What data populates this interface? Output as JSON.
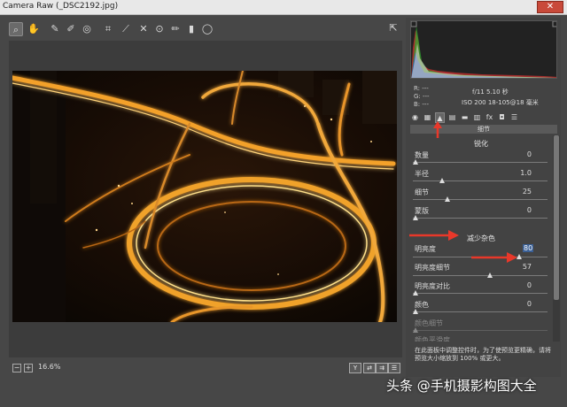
{
  "window": {
    "title": "Camera Raw (_DSC2192.jpg)",
    "close_icon": "close-icon"
  },
  "toolbar": {
    "tools": [
      "zoom-icon",
      "hand-icon",
      "eyedropper-icon",
      "color-sampler-icon",
      "target-adjust-icon",
      "crop-icon",
      "straighten-icon",
      "spot-removal-icon",
      "red-eye-icon",
      "adjustment-brush-icon",
      "graduated-filter-icon",
      "radial-filter-icon"
    ],
    "exit_icon": "open-preferences-icon"
  },
  "status": {
    "zoom_minus": "−",
    "zoom_plus": "+",
    "zoom_value": "16.6%",
    "view_y": "Y"
  },
  "info": {
    "r": "R:  ---",
    "g": "G:  ---",
    "b": "B:  ---",
    "aperture_time": "f/11   5.10 秒",
    "iso_lens": "ISO 200   18-105@18 毫米"
  },
  "panel": {
    "section_label": "细节",
    "sharpen": {
      "title": "锐化",
      "rows": [
        {
          "label": "数量",
          "value": "0"
        },
        {
          "label": "半径",
          "value": "1.0"
        },
        {
          "label": "细节",
          "value": "25"
        },
        {
          "label": "蒙版",
          "value": "0"
        }
      ]
    },
    "noise": {
      "title": "减少杂色",
      "rows": [
        {
          "label": "明亮度",
          "value": "80"
        },
        {
          "label": "明亮度细节",
          "value": "57"
        },
        {
          "label": "明亮度对比",
          "value": "0"
        },
        {
          "label": "颜色",
          "value": "0"
        },
        {
          "label": "颜色细节",
          "value": ""
        },
        {
          "label": "颜色平滑度",
          "value": ""
        }
      ]
    },
    "hint": "在此面板中调整控件时，为了使预览更精确，请将预览大小缩放到 100% 或更大。"
  },
  "watermark": "头条 @手机摄影构图大全",
  "colors": {
    "accent_arrow": "#e8382a",
    "selection": "#3a5f95"
  }
}
